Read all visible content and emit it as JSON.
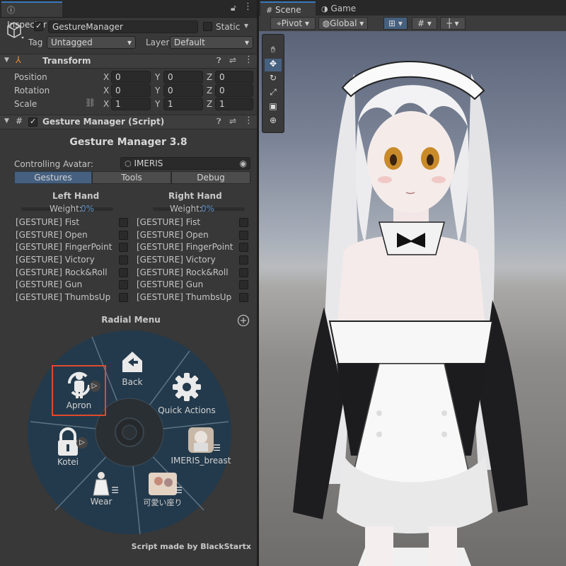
{
  "inspector": {
    "tab_label": "Inspector",
    "object_name": "GestureManager",
    "static_label": "Static",
    "tag_label": "Tag",
    "tag_value": "Untagged",
    "layer_label": "Layer",
    "layer_value": "Default",
    "transform": {
      "title": "Transform",
      "rows": [
        {
          "label": "Position",
          "x": "0",
          "y": "0",
          "z": "0"
        },
        {
          "label": "Rotation",
          "x": "0",
          "y": "0",
          "z": "0"
        },
        {
          "label": "Scale",
          "x": "1",
          "y": "1",
          "z": "1"
        }
      ],
      "axis_labels": [
        "X",
        "Y",
        "Z"
      ]
    },
    "script_title": "Gesture Manager (Script)"
  },
  "gesture_manager": {
    "title": "Gesture Manager 3.8",
    "controlling_label": "Controlling Avatar:",
    "avatar_name": "IMERIS",
    "tabs": [
      "Gestures",
      "Tools",
      "Debug"
    ],
    "left_hand": "Left Hand",
    "right_hand": "Right Hand",
    "weight_label": "Weight:",
    "weight_value": "0%",
    "gestures": [
      "[GESTURE] Fist",
      "[GESTURE] Open",
      "[GESTURE] FingerPoint",
      "[GESTURE] Victory",
      "[GESTURE] Rock&Roll",
      "[GESTURE] Gun",
      "[GESTURE] ThumbsUp"
    ],
    "radial_title": "Radial Menu",
    "radial_items": {
      "back": "Back",
      "quick": "Quick Actions",
      "breast": "IMERIS_breast",
      "sit": "可愛い座り",
      "wear": "Wear",
      "kotei": "Kotei",
      "apron": "Apron"
    },
    "footer": "Script made by BlackStartx"
  },
  "scene": {
    "tabs": [
      "Scene",
      "Game"
    ],
    "pivot": "Pivot",
    "global": "Global"
  },
  "colors": {
    "accent": "#3a79bb",
    "selection_box": "#e04a2a"
  }
}
